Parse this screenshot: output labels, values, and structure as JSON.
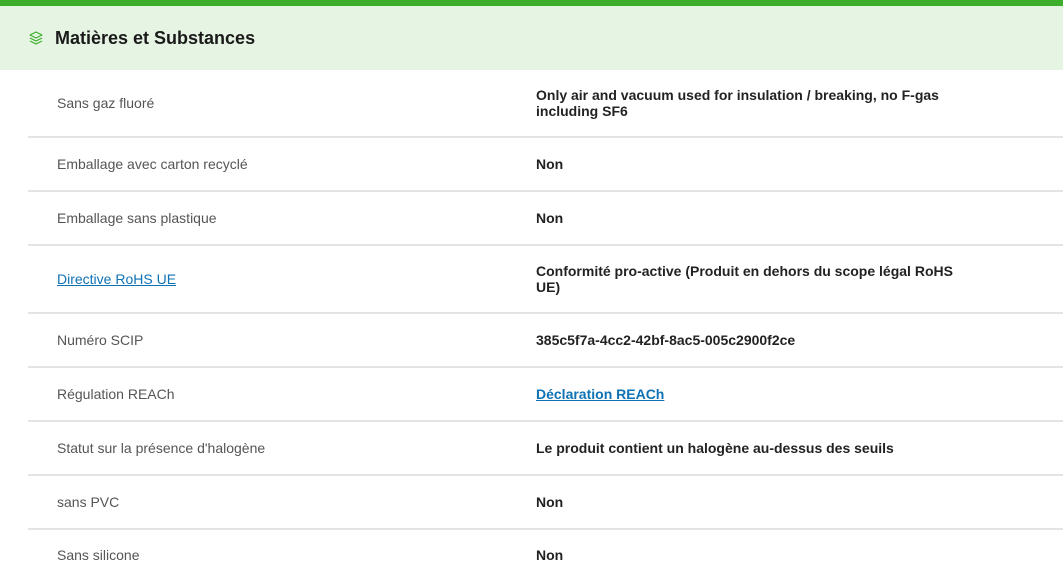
{
  "section": {
    "icon": "leaf-layers-icon",
    "title": "Matières et Substances",
    "accent_color": "#3dae2b",
    "header_bg": "#e6f5e3",
    "link_color": "#0f72b5"
  },
  "rows": [
    {
      "label": "Sans gaz fluoré",
      "value": "Only air and vacuum used for insulation / breaking, no F-gas including SF6"
    },
    {
      "label": "Emballage avec carton recyclé",
      "value": "Non"
    },
    {
      "label": "Emballage sans plastique",
      "value": "Non"
    },
    {
      "label": "Directive RoHS UE",
      "value": "Conformité pro-active (Produit en dehors du scope légal RoHS UE)"
    },
    {
      "label": "Numéro SCIP",
      "value": "385c5f7a-4cc2-42bf-8ac5-005c2900f2ce"
    },
    {
      "label": "Régulation REACh",
      "value": "Déclaration REACh"
    },
    {
      "label": "Statut sur la présence d'halogène",
      "value": "Le produit contient un halogène au-dessus des seuils"
    },
    {
      "label": "sans PVC",
      "value": "Non"
    },
    {
      "label": "Sans silicone",
      "value": "Non"
    }
  ]
}
